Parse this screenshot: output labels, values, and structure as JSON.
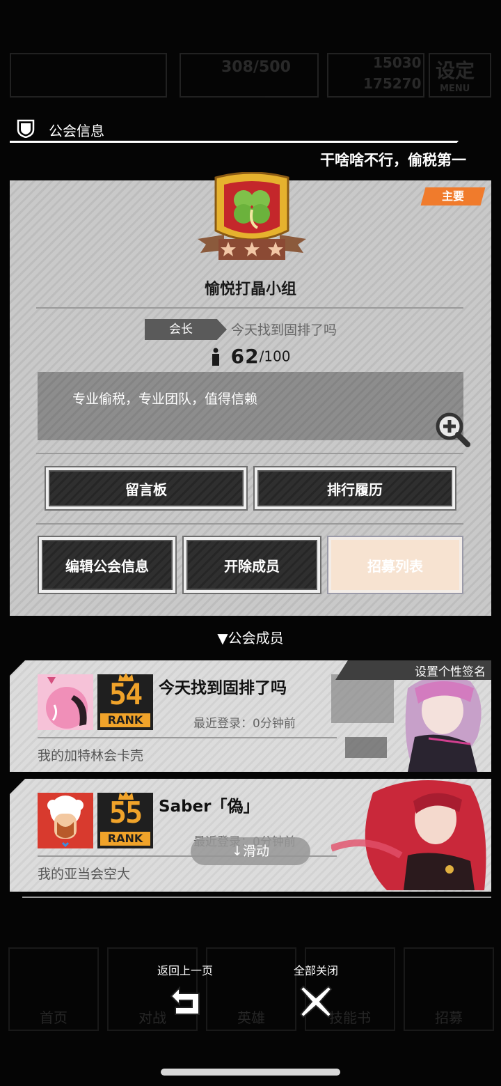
{
  "background_hud": {
    "item_count": "308/500",
    "currency_1": "15030",
    "currency_2": "175270",
    "settings_label": "设定",
    "settings_sub": "MENU",
    "bottom_labels": [
      "首页",
      "对战",
      "英雄",
      "技能书",
      "招募"
    ]
  },
  "header": {
    "title": "公会信息"
  },
  "motto": "干啥啥不行，偷税第一",
  "guild": {
    "tag": "主要",
    "name": "愉悦打晶小组",
    "leader_label": "会长",
    "leader_name": "今天找到固排了吗",
    "member_count": "62",
    "member_max": "/100",
    "description": "专业偷税，专业团队，值得信赖",
    "stars": 3
  },
  "buttons": {
    "message_board": "留言板",
    "ranking_history": "排行履历",
    "edit_info": "编辑公会信息",
    "kick_member": "开除成员",
    "recruit_list": "招募列表"
  },
  "members_title": "▼公会成员",
  "members": [
    {
      "name": "今天找到固排了吗",
      "rank": "54",
      "rank_label": "RANK",
      "login": "最近登录：0分钟前",
      "signature": "我的加特林会卡壳",
      "set_sig_label": "设置个性签名",
      "accent": "#f08fb8"
    },
    {
      "name": "Saber「偽」",
      "rank": "55",
      "rank_label": "RANK",
      "login": "最近登录：0分钟前",
      "signature": "我的亚当会空大",
      "accent": "#d83a2e"
    }
  ],
  "scroll_hint": "↓滑动",
  "nav": {
    "back_label": "返回上一页",
    "close_all_label": "全部关闭"
  },
  "colors": {
    "accent_orange": "#f07b2c",
    "rank_gold": "#f0a32a",
    "panel_gray": "#c9c9c9"
  }
}
